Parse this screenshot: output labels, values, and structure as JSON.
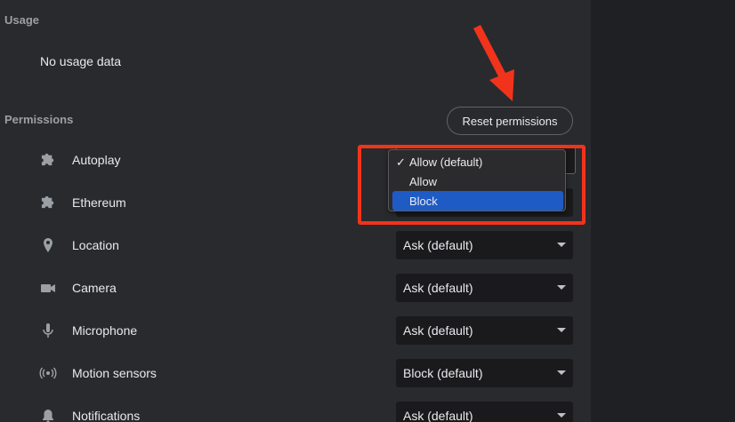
{
  "usage": {
    "heading": "Usage",
    "text": "No usage data"
  },
  "permissions": {
    "heading": "Permissions",
    "reset_label": "Reset permissions",
    "items": [
      {
        "label": "Autoplay",
        "icon": "puzzle-icon",
        "value": ""
      },
      {
        "label": "Ethereum",
        "icon": "puzzle-icon",
        "value": ""
      },
      {
        "label": "Location",
        "icon": "location-pin-icon",
        "value": "Ask (default)"
      },
      {
        "label": "Camera",
        "icon": "camera-icon",
        "value": "Ask (default)"
      },
      {
        "label": "Microphone",
        "icon": "microphone-icon",
        "value": "Ask (default)"
      },
      {
        "label": "Motion sensors",
        "icon": "motion-sensors-icon",
        "value": "Block (default)"
      },
      {
        "label": "Notifications",
        "icon": "bell-icon",
        "value": "Ask (default)"
      }
    ]
  },
  "dropdown": {
    "options": [
      {
        "label": "Allow (default)",
        "checked": true
      },
      {
        "label": "Allow",
        "checked": false
      },
      {
        "label": "Block",
        "checked": false,
        "highlighted": true
      }
    ],
    "check_mark": "✓"
  },
  "annotation": {
    "box_color": "#f2331c",
    "arrow_color": "#f2331c"
  },
  "colors": {
    "panel_bg": "#292a2d",
    "select_bg": "#1a1a1c",
    "highlight": "#1f5bc5"
  }
}
